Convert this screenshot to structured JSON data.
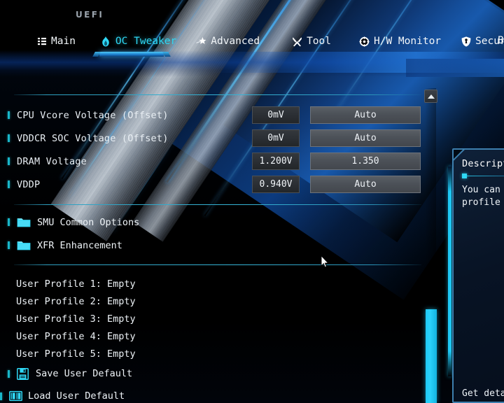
{
  "app": {
    "logo": "UEFI"
  },
  "nav": {
    "items": [
      {
        "label": "Main",
        "icon": "list-icon",
        "active": false
      },
      {
        "label": "OC Tweaker",
        "icon": "flame-icon",
        "active": true
      },
      {
        "label": "Advanced",
        "icon": "star-icon",
        "active": false
      },
      {
        "label": "Tool",
        "icon": "tools-icon",
        "active": false
      },
      {
        "label": "H/W Monitor",
        "icon": "gauge-icon",
        "active": false
      },
      {
        "label": "Security",
        "icon": "shield-icon",
        "active": false
      }
    ],
    "overflow_label": "B"
  },
  "settings": {
    "rows": [
      {
        "label": "CPU Vcore Voltage (Offset)",
        "value": "0mV",
        "selection": "Auto"
      },
      {
        "label": "VDDCR SOC Voltage (Offset)",
        "value": "0mV",
        "selection": "Auto"
      },
      {
        "label": "DRAM Voltage",
        "value": "1.200V",
        "selection": "1.350"
      },
      {
        "label": "VDDP",
        "value": "0.940V",
        "selection": "Auto"
      }
    ]
  },
  "submenus": {
    "items": [
      {
        "label": "SMU Common Options",
        "icon": "folder-icon"
      },
      {
        "label": "XFR Enhancement",
        "icon": "folder-icon"
      }
    ]
  },
  "profiles": {
    "entries": [
      "User Profile 1: Empty",
      "User Profile 2: Empty",
      "User Profile 3: Empty",
      "User Profile 4: Empty",
      "User Profile 5: Empty"
    ],
    "actions": [
      {
        "label": "Save User Default",
        "icon": "floppy-disk-icon"
      },
      {
        "label": "Load User Default",
        "icon": "book-icon"
      }
    ]
  },
  "description": {
    "title": "Description",
    "line1": "You can lo",
    "line2": "profile fr",
    "footer": "Get detail"
  },
  "scrollbar": {
    "up_arrow": "scroll-up-icon"
  },
  "colors": {
    "accent_cyan": "#2fd8f5",
    "separator": "#35b4d6",
    "bullet": "#19b6c9",
    "panel_border": "#3d7fae"
  }
}
